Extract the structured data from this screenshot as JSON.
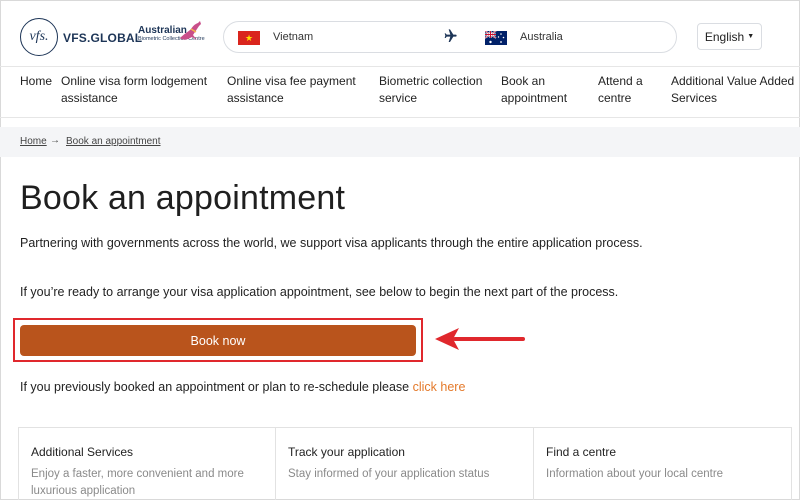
{
  "header": {
    "logo_text": "vfs.",
    "brand": "VFS.GLOBAL",
    "abc_title": "Australian",
    "abc_subtitle": "Biometric Collection Centre",
    "route": {
      "from": "Vietnam",
      "to": "Australia",
      "icon": "airplane-icon"
    },
    "language": "English"
  },
  "nav": {
    "items": [
      {
        "label_1": "Home",
        "label_2": ""
      },
      {
        "label_1": "Online visa form lodgement",
        "label_2": "assistance"
      },
      {
        "label_1": "Online visa fee payment",
        "label_2": "assistance"
      },
      {
        "label_1": "Biometric collection",
        "label_2": "service"
      },
      {
        "label_1": "Book an",
        "label_2": "appointment"
      },
      {
        "label_1": "Attend a",
        "label_2": "centre"
      },
      {
        "label_1": "Additional Value Added",
        "label_2": "Services"
      }
    ]
  },
  "breadcrumb": {
    "home": "Home",
    "arrow": "→",
    "current": "Book an appointment"
  },
  "main": {
    "title": "Book an appointment",
    "intro": "Partnering with governments across the world, we support visa applicants through the entire application process.",
    "ready_text": "If you’re ready to arrange your visa application appointment, see below to begin the next part of the process.",
    "book_button": "Book now",
    "reschedule_text": "If you previously booked an appointment or plan to re-schedule please ",
    "reschedule_link": "click here"
  },
  "cards": [
    {
      "title": "Additional Services",
      "desc": "Enjoy a faster, more convenient and more luxurious application"
    },
    {
      "title": "Track your application",
      "desc": "Stay informed of your application status"
    },
    {
      "title": "Find a centre",
      "desc": "Information about your local centre"
    }
  ],
  "colors": {
    "brand_navy": "#1d3557",
    "button": "#b9541c",
    "link": "#e4792a",
    "highlight": "#e0282d"
  }
}
